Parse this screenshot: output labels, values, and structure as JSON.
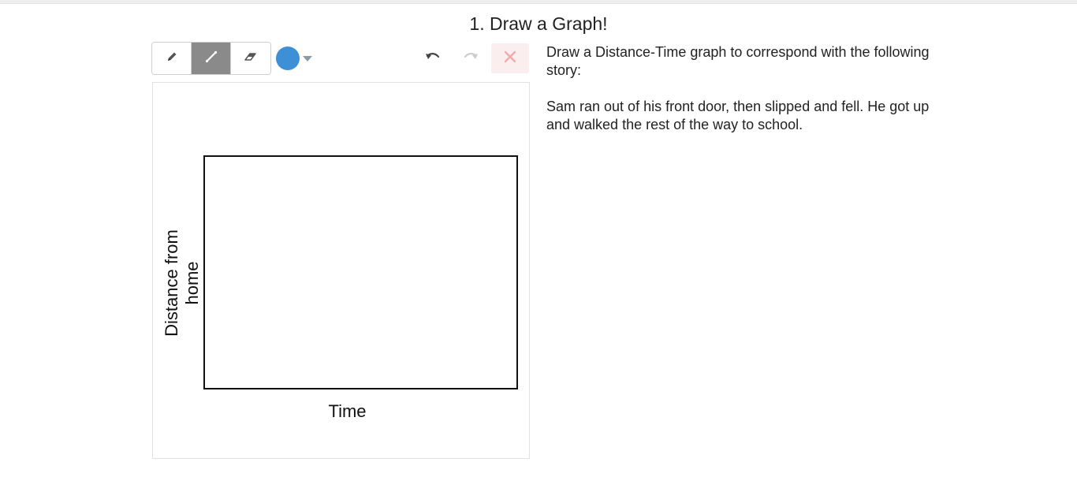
{
  "question": {
    "title": "1. Draw a Graph!"
  },
  "toolbar": {
    "tools": [
      {
        "name": "pencil",
        "icon": "pencil-icon",
        "active": false
      },
      {
        "name": "line",
        "icon": "line-icon",
        "active": true
      },
      {
        "name": "eraser",
        "icon": "eraser-icon",
        "active": false
      }
    ],
    "color": "#3d8fd6",
    "undo_icon": "undo-icon",
    "redo_icon": "redo-icon",
    "clear_icon": "close-icon",
    "clear_color": "#f3a9a9"
  },
  "canvas": {
    "x_label": "Time",
    "y_label_line1": "Distance from",
    "y_label_line2": "home"
  },
  "prompt": {
    "instruction": "Draw a Distance-Time graph to correspond with the following story:",
    "story": "Sam ran out of his front door, then slipped and fell. He got up and walked the rest of the way to school."
  }
}
